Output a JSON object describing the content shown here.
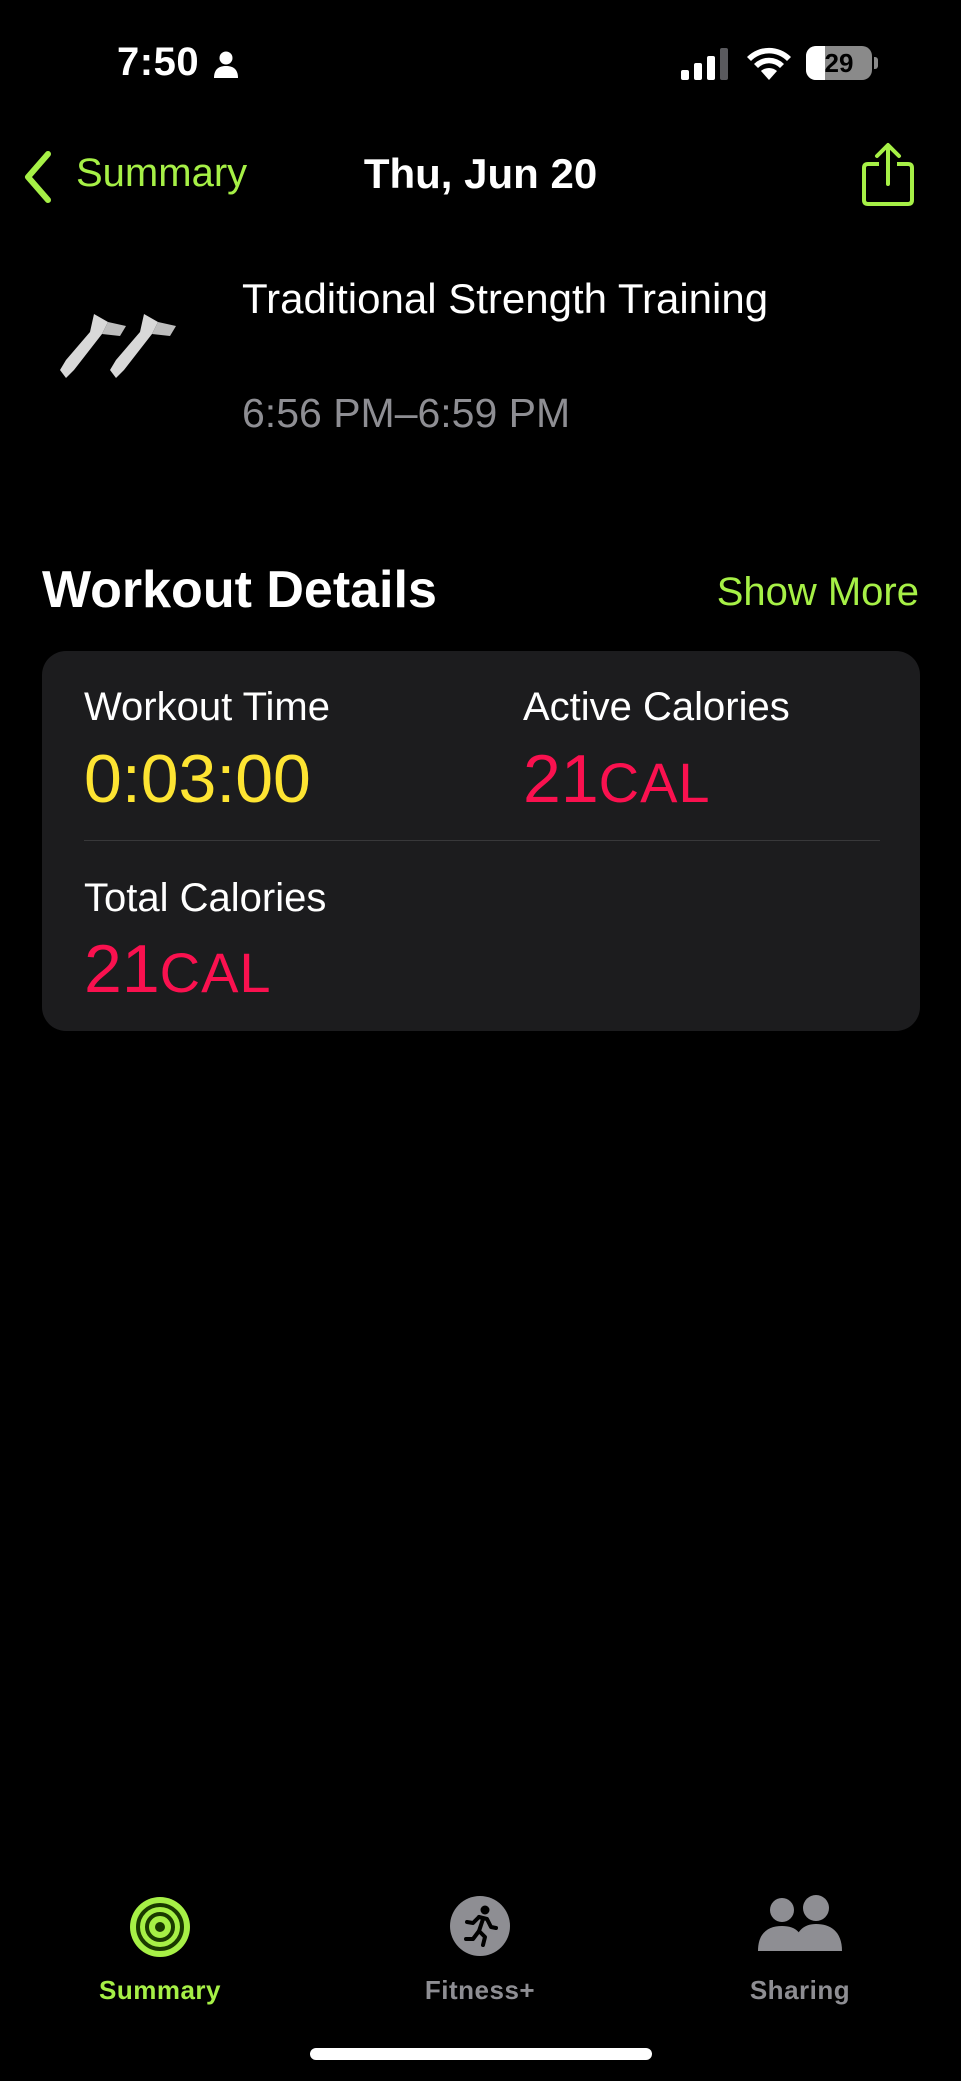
{
  "status_bar": {
    "time": "7:50",
    "battery_level": "29",
    "battery_fraction": 0.29,
    "icons": [
      "person-icon",
      "cellular-signal-icon",
      "wifi-icon",
      "battery-icon"
    ]
  },
  "nav": {
    "back_label": "Summary",
    "title": "Thu, Jun 20",
    "share_icon": "share-icon"
  },
  "workout": {
    "icon": "strength-training-icon",
    "name": "Traditional Strength Training",
    "time_range": "6:56 PM–6:59 PM"
  },
  "details": {
    "title": "Workout Details",
    "show_more": "Show More",
    "metrics": [
      {
        "label": "Workout Time",
        "value": "0:03:00",
        "unit": "",
        "color": "#fde432"
      },
      {
        "label": "Active Calories",
        "value": "21",
        "unit": "CAL",
        "color": "#fa114f"
      },
      {
        "label": "Total Calories",
        "value": "21",
        "unit": "CAL",
        "color": "#fa114f"
      }
    ]
  },
  "tabs": [
    {
      "label": "Summary",
      "icon": "activity-rings-icon",
      "active": true
    },
    {
      "label": "Fitness+",
      "icon": "runner-icon",
      "active": false
    },
    {
      "label": "Sharing",
      "icon": "people-icon",
      "active": false
    }
  ],
  "colors": {
    "accent": "#a6f046",
    "move": "#fa114f",
    "exercise_yellow": "#fde432",
    "inactive": "#8e8e93"
  }
}
